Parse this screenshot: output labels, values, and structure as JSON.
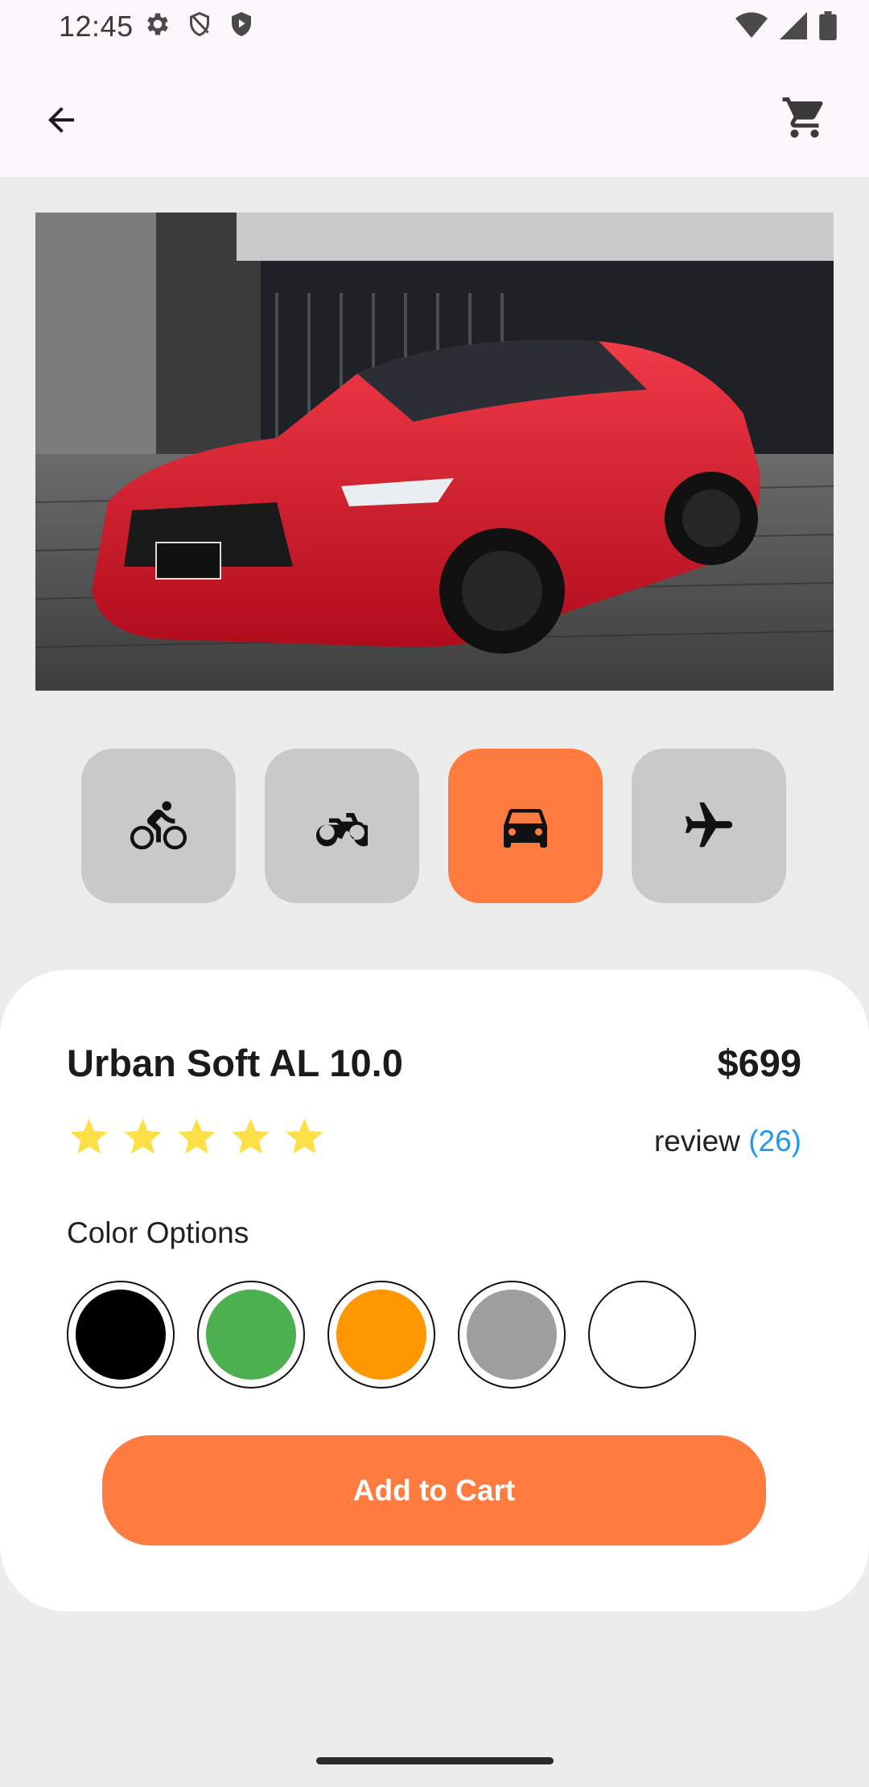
{
  "status_bar": {
    "time": "12:45"
  },
  "colors": {
    "accent": "#ff7b40",
    "link": "#2196f3",
    "star": "#fde047"
  },
  "icons": {
    "left_status": [
      "settings-gear-icon",
      "shield-icon",
      "play-shield-icon"
    ],
    "right_status": [
      "wifi-icon",
      "signal-icon",
      "battery-icon"
    ],
    "back": "arrow-back-icon",
    "cart": "shopping-cart-icon"
  },
  "categories": [
    {
      "icon": "bicycle-icon",
      "selected": false
    },
    {
      "icon": "motorcycle-icon",
      "selected": false
    },
    {
      "icon": "car-icon",
      "selected": true
    },
    {
      "icon": "airplane-icon",
      "selected": false
    }
  ],
  "product": {
    "title": "Urban Soft AL 10.0",
    "price": "$699",
    "rating": 5,
    "review_label": "review",
    "review_count": "(26)",
    "color_options_label": "Color Options",
    "color_options": [
      "#000000",
      "#4caf50",
      "#ff9800",
      "#9e9e9e",
      "#ffffff"
    ],
    "add_to_cart_label": "Add to Cart"
  }
}
